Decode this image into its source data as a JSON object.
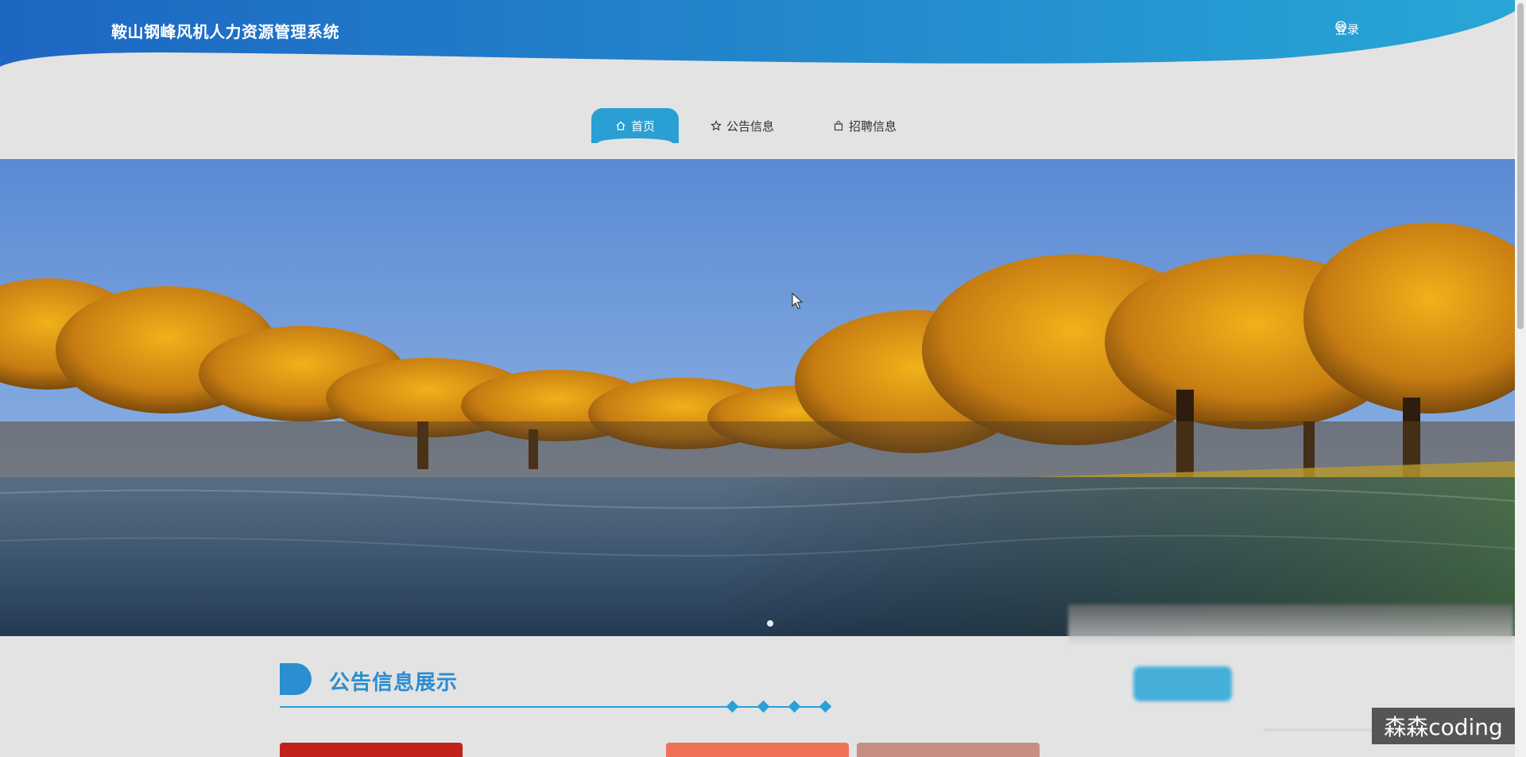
{
  "header": {
    "site_title": "鞍山钢峰风机人力资源管理系统",
    "login_label": "登录",
    "login_icon": "check-circle-icon",
    "gradient_start": "#1d66c2",
    "gradient_end": "#28a6d6"
  },
  "nav": {
    "items": [
      {
        "label": "首页",
        "icon": "home-icon",
        "active": true
      },
      {
        "label": "公告信息",
        "icon": "star-icon",
        "active": false
      },
      {
        "label": "招聘信息",
        "icon": "bag-icon",
        "active": false
      }
    ],
    "active_color": "#2a9fd3"
  },
  "banner": {
    "description_icon": "landscape-image",
    "dots": 1
  },
  "section": {
    "title": "公告信息展示",
    "accent_color": "#2a8ed0"
  },
  "watermark": {
    "text": "森森coding"
  }
}
